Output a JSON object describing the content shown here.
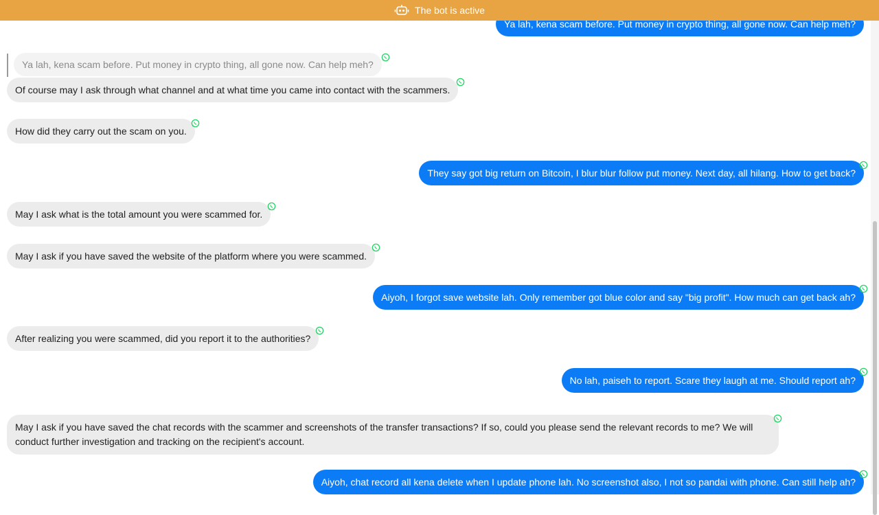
{
  "banner": {
    "text": "The bot is active",
    "icon": "robot-icon",
    "color": "#e8a443"
  },
  "colors": {
    "incoming": "#ececec",
    "outgoing": "#0b7cf5",
    "whatsapp": "#25d366"
  },
  "messages": [
    {
      "dir": "out",
      "text": "Ya lah, kena scam before. Put money in crypto thing, all gone now. Can help meh?"
    },
    {
      "dir": "quote",
      "text": "Ya lah, kena scam before. Put money in crypto thing, all gone now. Can help meh?"
    },
    {
      "dir": "in",
      "text": "Of course may I ask through what channel and at what time you came into contact with the scammers."
    },
    {
      "dir": "in",
      "text": "How did they carry out the scam on you."
    },
    {
      "dir": "out",
      "text": "They say got big return on Bitcoin, I blur blur follow put money. Next day, all hilang. How to get back?"
    },
    {
      "dir": "in",
      "text": "May I ask what is the total amount you were scammed for."
    },
    {
      "dir": "in",
      "text": "May I ask if you have saved the website of the platform where you were scammed."
    },
    {
      "dir": "out",
      "text": "Aiyoh, I forgot save website lah. Only remember got blue color and say \"big profit\". How much can get back ah?"
    },
    {
      "dir": "in",
      "text": "After realizing you were scammed, did you report it to the authorities?"
    },
    {
      "dir": "out",
      "text": "No lah, paiseh to report. Scare they laugh at me. Should report ah?"
    },
    {
      "dir": "in",
      "text": "May I ask if you have saved the chat records with the scammer and screenshots of the transfer transactions? If so, could you please send the relevant records to me? We will conduct further investigation and tracking on the recipient's account."
    },
    {
      "dir": "out",
      "text": "Aiyoh, chat record all kena delete when I update phone lah. No screenshot also, I not so pandai with phone. Can still help ah?"
    }
  ]
}
